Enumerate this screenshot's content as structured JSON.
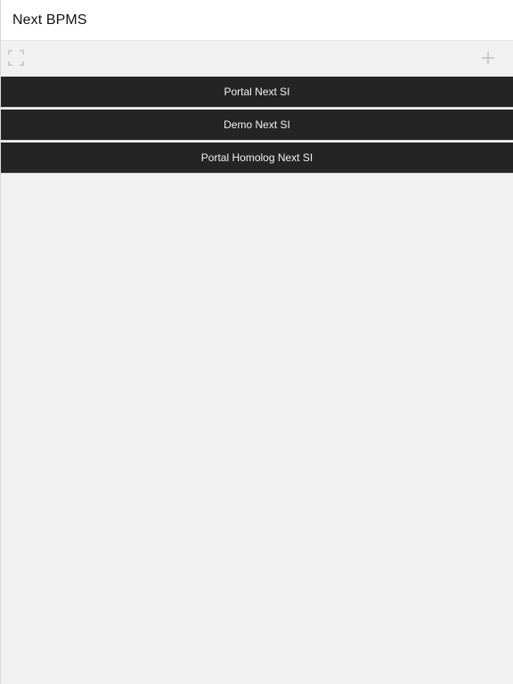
{
  "app": {
    "title": "Next BPMS"
  },
  "toolbar": {
    "left_icon": "fullscreen-icon",
    "right_icon": "plus-icon",
    "icon_color": "#c4c4c4"
  },
  "list": {
    "item_background": "#242424",
    "item_text_color": "#f2f2f2",
    "items": [
      {
        "label": "Portal Next SI"
      },
      {
        "label": "Demo Next SI"
      },
      {
        "label": "Portal Homolog Next SI"
      }
    ]
  }
}
